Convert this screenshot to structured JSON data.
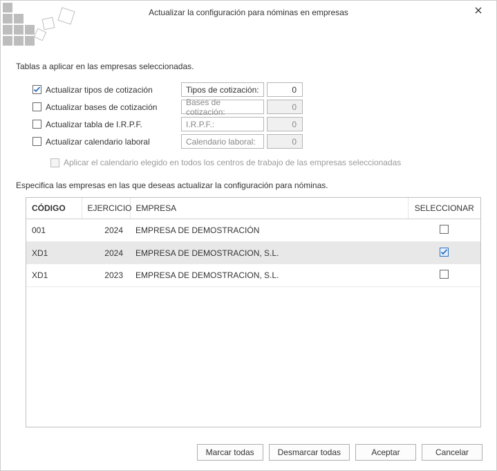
{
  "window": {
    "title": "Actualizar la configuración para nóminas en empresas"
  },
  "sections": {
    "tables_label": "Tablas a aplicar en las empresas seleccionadas.",
    "companies_label": "Especifica las empresas en las que deseas actualizar la configuración para nóminas."
  },
  "options": {
    "cotiz_tipos": {
      "checked": true,
      "label": "Actualizar tipos de cotización",
      "field_label": "Tipos de cotización:",
      "value": "0",
      "enabled": true
    },
    "cotiz_bases": {
      "checked": false,
      "label": "Actualizar bases de cotización",
      "field_label": "Bases de cotización:",
      "value": "0",
      "enabled": false
    },
    "irpf": {
      "checked": false,
      "label": "Actualizar tabla de I.R.P.F.",
      "field_label": "I.R.P.F.:",
      "value": "0",
      "enabled": false
    },
    "calendario": {
      "checked": false,
      "label": "Actualizar calendario laboral",
      "field_label": "Calendario laboral:",
      "value": "0",
      "enabled": false
    },
    "apply_all_centers": {
      "checked": false,
      "enabled": false,
      "label": "Aplicar el calendario elegido en todos los centros de trabajo de las empresas seleccionadas"
    }
  },
  "table": {
    "headers": {
      "code": "CÓDIGO",
      "year": "EJERCICIO",
      "company": "EMPRESA",
      "select": "SELECCIONAR"
    },
    "rows": [
      {
        "code": "001",
        "year": "2024",
        "company": "EMPRESA DE DEMOSTRACIÓN",
        "selected": false,
        "highlight": false
      },
      {
        "code": "XD1",
        "year": "2024",
        "company": "EMPRESA DE DEMOSTRACION, S.L.",
        "selected": true,
        "highlight": true
      },
      {
        "code": "XD1",
        "year": "2023",
        "company": "EMPRESA DE DEMOSTRACION, S.L.",
        "selected": false,
        "highlight": false
      }
    ]
  },
  "buttons": {
    "mark_all": "Marcar todas",
    "unmark_all": "Desmarcar todas",
    "accept": "Aceptar",
    "cancel": "Cancelar"
  }
}
